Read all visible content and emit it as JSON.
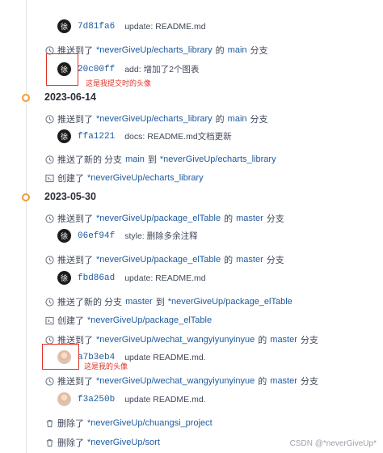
{
  "timeline": {
    "top_partial_commit": {
      "avatar_glyph": "徐",
      "sha": "7d81fa6",
      "message": "update: README.md"
    },
    "groups": [
      {
        "date": null,
        "events": [
          {
            "type": "push",
            "prefix": "推送到了",
            "repo": "*neverGiveUp/echarts_library",
            "mid": "的",
            "branch": "main",
            "suffix": "分支"
          },
          {
            "type": "commit",
            "avatar_glyph": "徐",
            "sha": "20c00ff",
            "message": "add: 增加了2个图表"
          }
        ]
      },
      {
        "date": "2023-06-14",
        "events": [
          {
            "type": "push",
            "prefix": "推送到了",
            "repo": "*neverGiveUp/echarts_library",
            "mid": "的",
            "branch": "main",
            "suffix": "分支"
          },
          {
            "type": "commit",
            "avatar_glyph": "徐",
            "sha": "ffa1221",
            "message": "docs: README.md文档更新"
          },
          {
            "type": "new_branch",
            "prefix": "推送了新的 分支",
            "branch": "main",
            "mid": "到",
            "repo": "*neverGiveUp/echarts_library"
          },
          {
            "type": "create",
            "prefix": "创建了",
            "repo": "*neverGiveUp/echarts_library"
          }
        ]
      },
      {
        "date": "2023-05-30",
        "events": [
          {
            "type": "push",
            "prefix": "推送到了",
            "repo": "*neverGiveUp/package_elTable",
            "mid": "的",
            "branch": "master",
            "suffix": "分支"
          },
          {
            "type": "commit",
            "avatar_glyph": "徐",
            "sha": "06ef94f",
            "message": "style: 删除多余注释"
          },
          {
            "type": "push",
            "prefix": "推送到了",
            "repo": "*neverGiveUp/package_elTable",
            "mid": "的",
            "branch": "master",
            "suffix": "分支"
          },
          {
            "type": "commit",
            "avatar_glyph": "徐",
            "sha": "fbd86ad",
            "message": "update: README.md"
          },
          {
            "type": "new_branch",
            "prefix": "推送了新的 分支",
            "branch": "master",
            "mid": "到",
            "repo": "*neverGiveUp/package_elTable"
          },
          {
            "type": "create",
            "prefix": "创建了",
            "repo": "*neverGiveUp/package_elTable"
          },
          {
            "type": "push",
            "prefix": "推送到了",
            "repo": "*neverGiveUp/wechat_wangyiyunyinyue",
            "mid": "的",
            "branch": "master",
            "suffix": "分支"
          },
          {
            "type": "commit",
            "avatar_glyph": "",
            "sha": "a7b3eb4",
            "message": "update README.md."
          },
          {
            "type": "push",
            "prefix": "推送到了",
            "repo": "*neverGiveUp/wechat_wangyiyunyinyue",
            "mid": "的",
            "branch": "master",
            "suffix": "分支"
          },
          {
            "type": "commit",
            "avatar_glyph": "",
            "sha": "f3a250b",
            "message": "update README.md."
          },
          {
            "type": "delete",
            "prefix": "删除了",
            "repo": "*neverGiveUp/chuangsi_project"
          },
          {
            "type": "delete",
            "prefix": "删除了",
            "repo": "*neverGiveUp/sort"
          }
        ]
      }
    ]
  },
  "annotations": {
    "commit_avatar_note": "这是我提交时的头像",
    "profile_avatar_note": "这是我的头像"
  },
  "watermark": "CSDN @*neverGiveUp*",
  "colors": {
    "link": "#1e5a9e",
    "annotation": "#e0322b",
    "date_dot": "#f29c38"
  }
}
